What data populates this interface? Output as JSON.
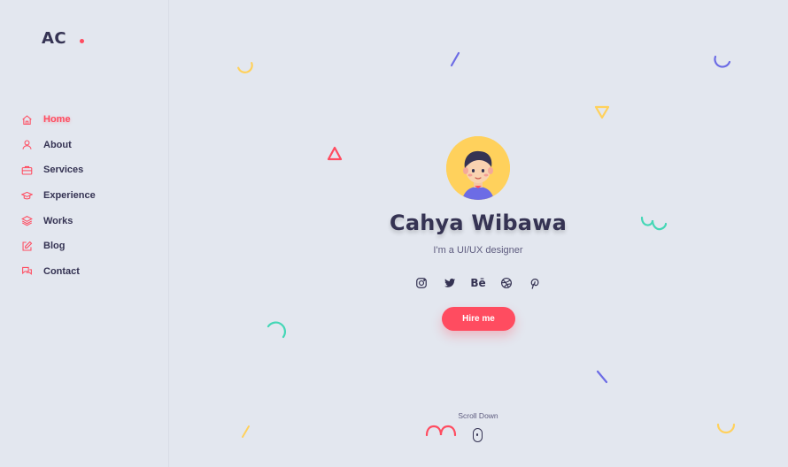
{
  "logo": {
    "text": "AC"
  },
  "nav": {
    "items": [
      {
        "label": "Home",
        "icon": "home-icon",
        "active": true
      },
      {
        "label": "About",
        "icon": "user-icon"
      },
      {
        "label": "Services",
        "icon": "briefcase-icon"
      },
      {
        "label": "Experience",
        "icon": "graduation-cap-icon"
      },
      {
        "label": "Works",
        "icon": "layers-icon"
      },
      {
        "label": "Blog",
        "icon": "edit-icon"
      },
      {
        "label": "Contact",
        "icon": "chat-bubbles-icon"
      }
    ]
  },
  "hero": {
    "name": "Cahya Wibawa",
    "subtitle": "I'm a UI/UX designer",
    "socials": [
      "instagram-icon",
      "twitter-icon",
      "behance-icon",
      "dribbble-icon",
      "pinterest-icon"
    ],
    "behance_text": "Bē",
    "hire_label": "Hire me"
  },
  "scroll": {
    "label": "Scroll Down"
  },
  "colors": {
    "accent": "#ff4c60",
    "text": "#353353",
    "background": "#e3e7ef",
    "avatar_bg": "#ffd15c",
    "shape_yellow": "#ffd15c",
    "shape_purple": "#6c6ce5",
    "shape_green": "#44d7b6"
  }
}
